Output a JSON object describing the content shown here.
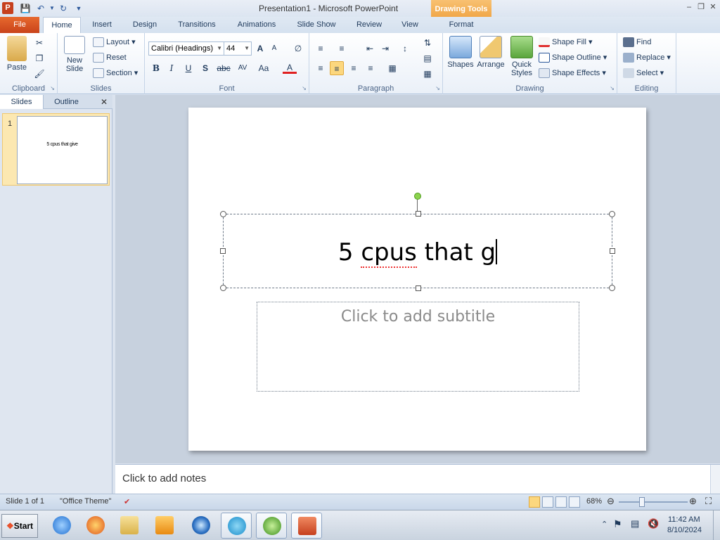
{
  "window": {
    "title": "Presentation1 - Microsoft PowerPoint",
    "contextual_header": "Drawing Tools",
    "app_icon_letter": "P"
  },
  "tabs": {
    "file": "File",
    "home": "Home",
    "insert": "Insert",
    "design": "Design",
    "transitions": "Transitions",
    "animations": "Animations",
    "slide_show": "Slide Show",
    "review": "Review",
    "view": "View",
    "format": "Format"
  },
  "ribbon": {
    "clipboard": {
      "paste": "Paste",
      "label": "Clipboard"
    },
    "slides": {
      "new_slide": "New Slide",
      "layout": "Layout",
      "reset": "Reset",
      "section": "Section",
      "label": "Slides"
    },
    "font": {
      "family": "Calibri (Headings)",
      "size": "44",
      "label": "Font",
      "bold": "B",
      "italic": "I",
      "underline": "U",
      "shadow": "S",
      "strike": "abc",
      "spacing": "AV",
      "case": "Aa",
      "color": "A",
      "grow": "A",
      "shrink": "A"
    },
    "paragraph": {
      "label": "Paragraph"
    },
    "drawing": {
      "shapes": "Shapes",
      "arrange": "Arrange",
      "quick_styles": "Quick Styles",
      "shape_fill": "Shape Fill",
      "shape_outline": "Shape Outline",
      "shape_effects": "Shape Effects",
      "label": "Drawing"
    },
    "editing": {
      "find": "Find",
      "replace": "Replace",
      "select": "Select",
      "label": "Editing"
    }
  },
  "left_panel": {
    "tab_slides": "Slides",
    "tab_outline": "Outline",
    "thumbnails": [
      {
        "number": "1",
        "text": "5 cpus that give"
      }
    ]
  },
  "slide": {
    "title_text": "5 cpus that g",
    "title_misspelled": "cpus",
    "subtitle_placeholder": "Click to add subtitle"
  },
  "notes": {
    "placeholder": "Click to add notes"
  },
  "status": {
    "slide_info": "Slide 1 of 1",
    "theme": "\"Office Theme\"",
    "zoom": "68%",
    "zoom_fraction": 0.34
  },
  "taskbar": {
    "start": "Start",
    "time": "11:42 AM",
    "date": "8/10/2024"
  }
}
